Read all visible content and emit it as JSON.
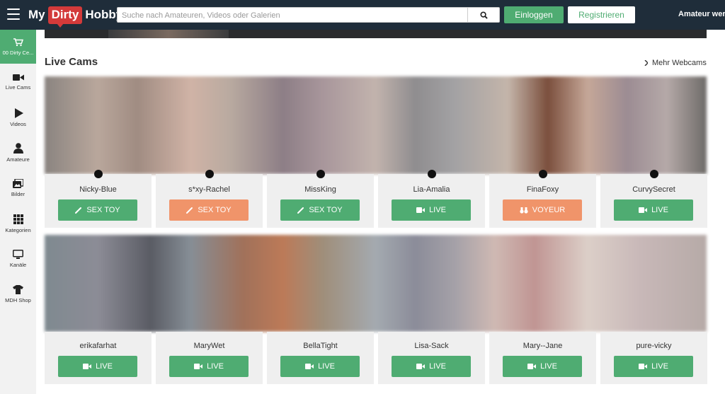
{
  "header": {
    "logo": {
      "my": "My",
      "dirty": "Dirty",
      "hobby": "Hobby"
    },
    "search_placeholder": "Suche nach Amateuren, Videos oder Galerien",
    "login_label": "Einloggen",
    "register_label": "Registrieren",
    "amateur_link": "Amateur werden"
  },
  "sidebar": {
    "items": [
      {
        "label": "00 Dirty Ce...",
        "icon": "cart-icon",
        "active": true
      },
      {
        "label": "Live Cams",
        "icon": "video-camera-icon"
      },
      {
        "label": "Videos",
        "icon": "play-icon"
      },
      {
        "label": "Amateure",
        "icon": "user-icon"
      },
      {
        "label": "Bilder",
        "icon": "images-icon"
      },
      {
        "label": "Kategorien",
        "icon": "grid-icon"
      },
      {
        "label": "Kanäle",
        "icon": "monitor-icon"
      },
      {
        "label": "MDH Shop",
        "icon": "tshirt-icon"
      }
    ]
  },
  "main": {
    "section_title": "Live Cams",
    "more_link": "Mehr Webcams",
    "cams": [
      {
        "name": "Nicky-Blue",
        "button": "SEX TOY",
        "type": "toy",
        "color": "green"
      },
      {
        "name": "s*xy-Rachel",
        "button": "SEX TOY",
        "type": "toy",
        "color": "orange"
      },
      {
        "name": "MissKing",
        "button": "SEX TOY",
        "type": "toy",
        "color": "green"
      },
      {
        "name": "Lia-Amalia",
        "button": "LIVE",
        "type": "live",
        "color": "green"
      },
      {
        "name": "FinaFoxy",
        "button": "VOYEUR",
        "type": "voyeur",
        "color": "orange"
      },
      {
        "name": "CurvySecret",
        "button": "LIVE",
        "type": "live",
        "color": "green"
      },
      {
        "name": "erikafarhat",
        "button": "LIVE",
        "type": "live",
        "color": "green"
      },
      {
        "name": "MaryWet",
        "button": "LIVE",
        "type": "live",
        "color": "green"
      },
      {
        "name": "BellaTight",
        "button": "LIVE",
        "type": "live",
        "color": "green"
      },
      {
        "name": "Lisa-Sack",
        "button": "LIVE",
        "type": "live",
        "color": "green"
      },
      {
        "name": "Mary--Jane",
        "button": "LIVE",
        "type": "live",
        "color": "green"
      },
      {
        "name": "pure-vicky",
        "button": "LIVE",
        "type": "live",
        "color": "green"
      }
    ]
  },
  "colors": {
    "topbar": "#1f2d3a",
    "green": "#4fac72",
    "orange": "#f0946a",
    "logo_red": "#d33a3a"
  }
}
